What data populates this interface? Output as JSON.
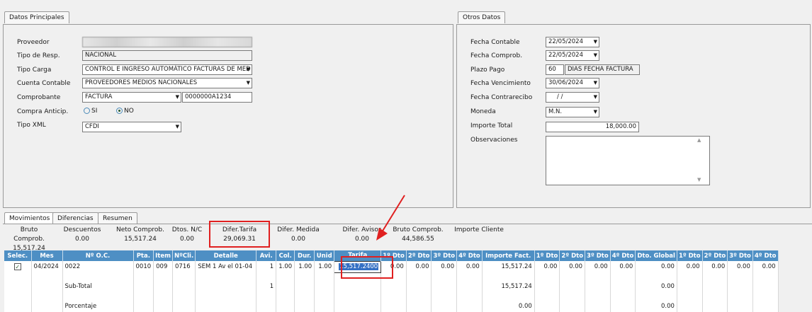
{
  "datos_principales": {
    "tab": "Datos Principales",
    "proveedor_label": "Proveedor",
    "tipo_resp_label": "Tipo de Resp.",
    "tipo_resp_value": "NACIONAL",
    "tipo_carga_label": "Tipo Carga",
    "tipo_carga_value": "CONTROL E INGRESO AUTOMÁTICO FACTURAS DE MED",
    "cuenta_contable_label": "Cuenta Contable",
    "cuenta_contable_value": "PROVEEDORES MEDIOS NACIONALES",
    "comprobante_label": "Comprobante",
    "comprobante_value": "FACTURA",
    "comprobante_num": "0000000A1234",
    "compra_anticip_label": "Compra Anticip.",
    "radio_si": "SI",
    "radio_no": "NO",
    "tipo_xml_label": "Tipo XML",
    "tipo_xml_value": "CFDI"
  },
  "otros_datos": {
    "tab": "Otros Datos",
    "fecha_contable_label": "Fecha Contable",
    "fecha_contable_value": "22/05/2024",
    "fecha_comprob_label": "Fecha Comprob.",
    "fecha_comprob_value": "22/05/2024",
    "plazo_pago_label": "Plazo Pago",
    "plazo_pago_value": "60",
    "plazo_pago_desc": "DIAS FECHA FACTURA",
    "fecha_venc_label": "Fecha Vencimiento",
    "fecha_venc_value": "30/06/2024",
    "fecha_contra_label": "Fecha Contrarecibo",
    "fecha_contra_value": "/ /",
    "moneda_label": "Moneda",
    "moneda_value": "M.N.",
    "importe_total_label": "Importe Total",
    "importe_total_value": "18,000.00",
    "observaciones_label": "Observaciones"
  },
  "bottom_tabs": [
    "Movimientos",
    "Diferencias",
    "Resumen"
  ],
  "summary": [
    {
      "label": "Bruto Comprob.",
      "value": "15,517.24"
    },
    {
      "label": "Descuentos",
      "value": "0.00"
    },
    {
      "label": "Neto Comprob.",
      "value": "15,517.24"
    },
    {
      "label": "Dtos. N/C",
      "value": "0.00"
    },
    {
      "label": "Difer.Tarifa",
      "value": "29,069.31"
    },
    {
      "label": "Difer. Medida",
      "value": "0.00"
    },
    {
      "label": "Difer. Avisos",
      "value": "0.00"
    },
    {
      "label": "Bruto Comprob.",
      "value": "44,586.55"
    },
    {
      "label": "Importe Cliente",
      "value": ""
    }
  ],
  "grid": {
    "headers": [
      "Selec.",
      "Mes",
      "Nº O.C.",
      "Pta.",
      "Item",
      "NºCli.",
      "Detalle",
      "Avi.",
      "Col.",
      "Dur.",
      "Unid",
      "Tarifa",
      "1º Dto",
      "2º Dto",
      "3º Dto",
      "4º Dto",
      "Importe Fact.",
      "1º Dto",
      "2º Dto",
      "3º Dto",
      "4º Dto",
      "Dto. Global",
      "1º Dto",
      "2º Dto",
      "3º Dto",
      "4º Dto"
    ],
    "row": {
      "checked": "✓",
      "mes": "04/2024",
      "oc": "0022",
      "pta": "0010",
      "item": "009",
      "cli": "0716",
      "detalle": "SEM 1 Av el 01-04",
      "avi": "1",
      "col": "1.00",
      "dur": "1.00",
      "unid": "1.00",
      "tarifa": "15,517.2400",
      "d1": "0.00",
      "d2": "0.00",
      "d3": "0.00",
      "d4": "0.00",
      "importe": "15,517.24",
      "e1": "0.00",
      "e2": "0.00",
      "e3": "0.00",
      "e4": "0.00",
      "global": "0.00",
      "f1": "0.00",
      "f2": "0.00",
      "f3": "0.00",
      "f4": "0.00"
    },
    "subtotal_label": "Sub-Total",
    "subtotal_avi": "1",
    "subtotal_importe": "15,517.24",
    "subtotal_global": "0.00",
    "partial_label": "Porcentaje",
    "partial_importe": "0.00",
    "partial_global": "0.00"
  },
  "colors": {
    "header_blue": "#4e8fc4",
    "highlight_red": "#e02020",
    "selection_blue": "#3470c4"
  }
}
